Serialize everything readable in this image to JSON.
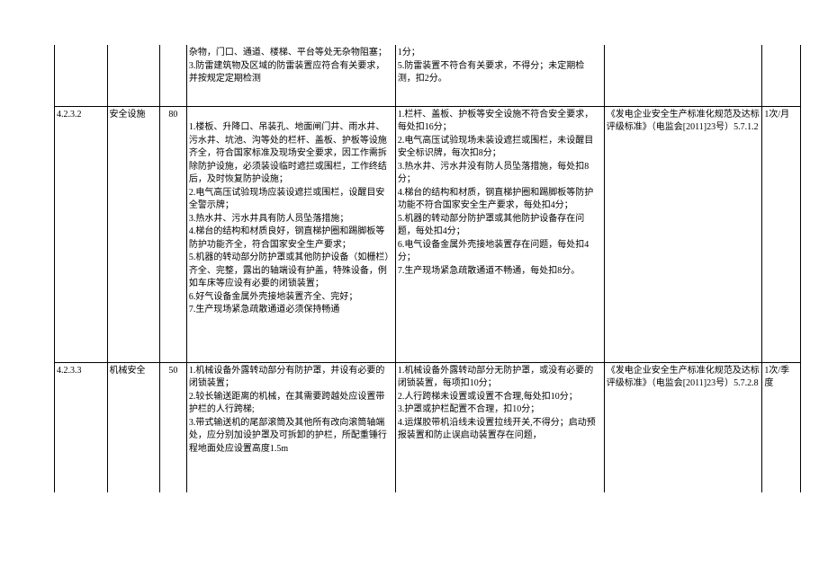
{
  "rows": [
    {
      "idx": "",
      "name": "",
      "score": "",
      "req": "杂物，门口、通道、楼梯、平台等处无杂物阻塞；\n3.防雷建筑物及区域的防雷装置应符合有关要求，并按规定定期检测",
      "criteria": "1分；\n5.防雷装置不符合有关要求，不得分；未定期检测，扣2分。",
      "basis": "",
      "freq": ""
    },
    {
      "idx": "4.2.3.2",
      "name": "安全设施",
      "score": "80",
      "req": "\n1.楼板、升降口、吊装孔、地面闸门井、雨水井、污水井、坑池、沟等处的栏杆、盖板、护板等设施齐全，符合国家标准及现场安全要求，因工作需拆除防护设施，必须装设临时遮拦或围栏，工作终结后，及时恢复防护设施；\n2.电气高压试验现场应装设遮拦或围栏，设醒目安全警示牌；\n3.热水井、污水井具有防人员坠落措施；\n4.梯台的结构和材质良好，钢直梯护圈和踢脚板等防护功能齐全，符合国家安全生产要求；\n5.机器的转动部分防护罩或其他防护设备（如栅栏）齐全、完整，露出的轴端设有护盖，特殊设备，例如车床等应设有必要的闭锁装置；\n6.好气设备金属外壳接地装置齐全、完好；\n7.生产现场紧急疏散通道必须保持畅通",
      "criteria": "1.栏杆、盖板、护板等安全设施不符合安全要求，每处扣16分；\n2.电气高压试验现场未装设遮拦或围栏，未设醒目安全标识牌，每次扣8分；\n3.热水井、污水井没有防人员坠落措施，每处扣8分；\n4.梯台的结构和材质，钢直梯护圈和踢脚板等防护功能不符合国家安全生产要求，每处扣4分；\n5.机器的转动部分防护罩或其他防护设备存在问题，每处扣4分；\n6.电气设备金属外壳接地装置存在问题，每处扣4分；\n7.生产现场紧急疏散通道不畅通，每处扣8分。",
      "basis": "《发电企业安全生产标准化规范及达标评级标准》（电监会[2011]23号）5.7.1.2",
      "freq": "1次/月"
    },
    {
      "idx": "4.2.3.3",
      "name": "机械安全",
      "score": "50",
      "req": "1.机械设备外露转动部分有防护罩，并设有必要的闭锁装置；\n2.较长输送距离的机械，在其需要跨越处应设置带护栏的人行跨梯;\n3.带式输送机的尾部滚筒及其他所有改向滚筒轴端处，应分别加设护罩及可拆卸的护栏，所配重锤行程地面处应设置高度1.5m",
      "criteria": "1.机械设备外露转动部分无防护罩，或没有必要的闭锁装置，每项扣10分；\n2.人行跨梯未设置或设置不合理,每处扣10分；\n3.护罩或护栏配置不合理，扣10分；\n4.运煤胶带机沿线未设置拉线开关,不得分；启动预报装置和防止误启动装置存在问题，",
      "basis": "《发电企业安全生产标准化规范及达标评级标准》（电监会[2011]23号）5.7.2.8",
      "freq": "1次/季度"
    }
  ]
}
